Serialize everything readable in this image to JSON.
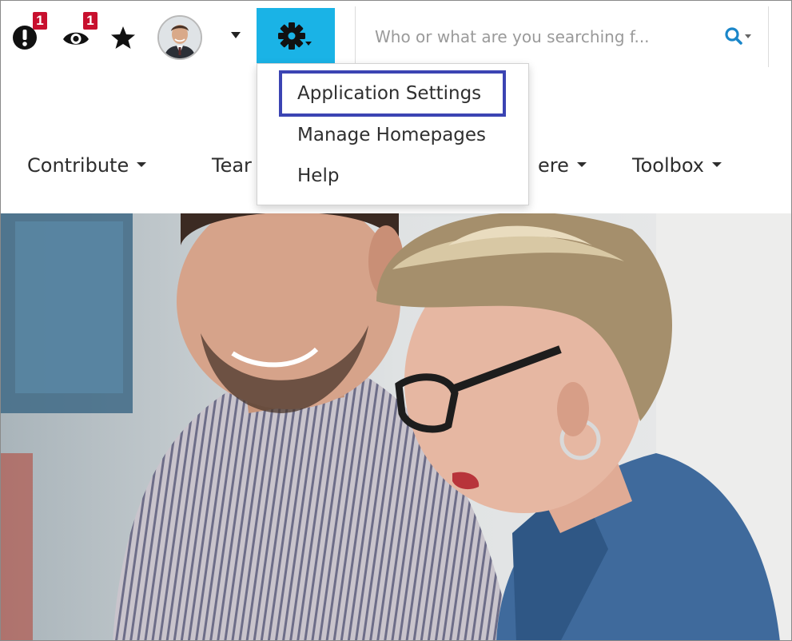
{
  "toolbar": {
    "alerts_badge": "1",
    "watch_badge": "1",
    "icons": {
      "alerts": "exclamation-icon",
      "watch": "eye-icon",
      "favorites": "star-icon",
      "profile_menu": "caret-down-icon",
      "settings": "gear-icon",
      "search": "search-icon"
    },
    "settings_button_color": "#1ab3e6"
  },
  "search": {
    "placeholder": "Who or what are you searching f..."
  },
  "settings_menu": {
    "items": [
      {
        "label": "Application Settings",
        "highlighted": true
      },
      {
        "label": "Manage Homepages"
      },
      {
        "label": "Help"
      }
    ],
    "highlight_color": "#3b44b3"
  },
  "nav": {
    "items": [
      {
        "label": "Contribute"
      },
      {
        "label": "Tear"
      },
      {
        "label": "ere"
      },
      {
        "label": "Toolbox"
      }
    ]
  },
  "badge_color": "#c8102e"
}
